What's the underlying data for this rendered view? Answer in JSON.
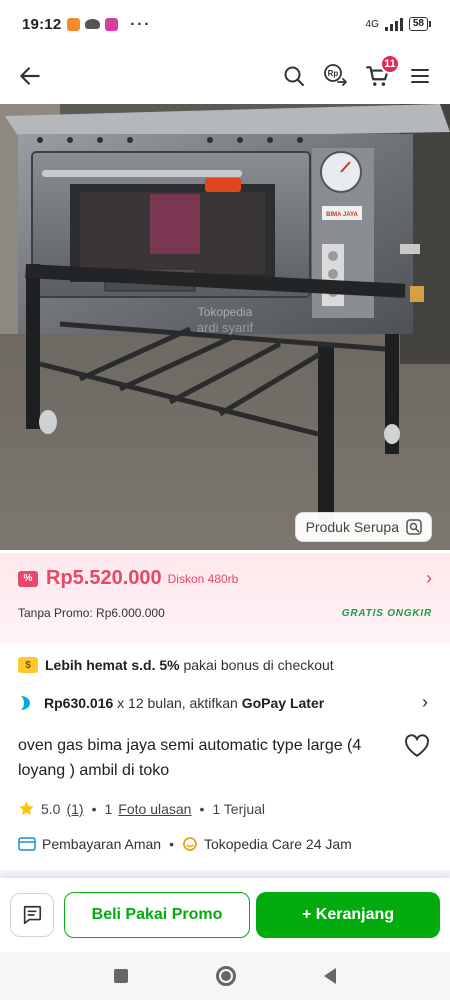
{
  "status_bar": {
    "time": "19:12",
    "more": "···",
    "network": "4G",
    "battery": "58"
  },
  "header": {
    "back_icon": "arrow-left-icon",
    "cart_count": "11"
  },
  "product_image": {
    "watermark_line1": "Tokopedia",
    "watermark_line2": "ardi syarif",
    "brand_plate": "BIMA JAYA",
    "similar_button": "Produk Serupa"
  },
  "price": {
    "value": "Rp5.520.000",
    "discount": "Diskon 480rb",
    "without_promo": "Tanpa Promo: Rp6.000.000",
    "shipping_badge": "GRATIS ONGKIR"
  },
  "bonus": {
    "bold": "Lebih hemat s.d. 5%",
    "rest": "pakai bonus di checkout"
  },
  "paylater": {
    "amount": "Rp630.016",
    "mid": "x 12 bulan, aktifkan",
    "brand": "GoPay Later"
  },
  "product": {
    "title": "oven gas bima jaya semi automatic type large (4 loyang ) ambil di toko"
  },
  "rating": {
    "score": "5.0",
    "count": "(1)",
    "reviews_num": "1",
    "reviews_label": "Foto ulasan",
    "sold": "1 Terjual"
  },
  "assurance": {
    "payment": "Pembayaran Aman",
    "care": "Tokopedia Care 24 Jam"
  },
  "actions": {
    "buy_promo": "Beli Pakai Promo",
    "add_cart": "+ Keranjang"
  },
  "colors": {
    "accent_green": "#03ac0e",
    "price_red": "#e8476a"
  }
}
